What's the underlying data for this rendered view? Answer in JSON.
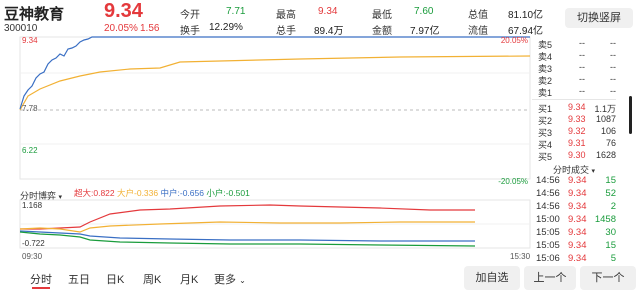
{
  "header": {
    "name": "豆神教育",
    "code": "300010",
    "price": "9.34",
    "change_pct": "20.05%",
    "change_abs": "1.56",
    "switch_button": "切换竖屏",
    "stats": [
      {
        "label": "今开",
        "value": "7.71",
        "color": "green"
      },
      {
        "label": "最高",
        "value": "9.34",
        "color": "red"
      },
      {
        "label": "最低",
        "value": "7.60",
        "color": "green"
      },
      {
        "label": "总值",
        "value": "81.10亿",
        "color": "black"
      },
      {
        "label": "换手",
        "value": "12.29%",
        "color": "black"
      },
      {
        "label": "总手",
        "value": "89.4万",
        "color": "black"
      },
      {
        "label": "金额",
        "value": "7.97亿",
        "color": "black"
      },
      {
        "label": "流值",
        "value": "67.94亿",
        "color": "black"
      }
    ]
  },
  "price_chart": {
    "y_top": "9.34",
    "y_ref": "7.78",
    "y_bottom": "6.22",
    "pct_top": "20.05%",
    "pct_bottom": "-20.05%"
  },
  "flow_chart": {
    "label": "分时博弈",
    "legend": [
      {
        "text": "超大:0.822",
        "color": "#e4393c"
      },
      {
        "text": "大户-0.336",
        "color": "#f2b134"
      },
      {
        "text": "中户:-0.656",
        "color": "#3a6fc4"
      },
      {
        "text": "小户:-0.501",
        "color": "#1a9c3c"
      }
    ],
    "y_top": "1.168",
    "y_bottom": "-0.722",
    "x_start": "09:30",
    "x_end": "15:30"
  },
  "order_book": {
    "asks": [
      {
        "label": "卖5",
        "price": "--",
        "vol": "--"
      },
      {
        "label": "卖4",
        "price": "--",
        "vol": "--"
      },
      {
        "label": "卖3",
        "price": "--",
        "vol": "--"
      },
      {
        "label": "卖2",
        "price": "--",
        "vol": "--"
      },
      {
        "label": "卖1",
        "price": "--",
        "vol": "--"
      }
    ],
    "bids": [
      {
        "label": "买1",
        "price": "9.34",
        "vol": "1.1万"
      },
      {
        "label": "买2",
        "price": "9.33",
        "vol": "1087"
      },
      {
        "label": "买3",
        "price": "9.32",
        "vol": "106"
      },
      {
        "label": "买4",
        "price": "9.31",
        "vol": "76"
      },
      {
        "label": "买5",
        "price": "9.30",
        "vol": "1628"
      }
    ]
  },
  "trades": {
    "title": "分时成交",
    "rows": [
      {
        "time": "14:56",
        "price": "9.34",
        "vol": "15",
        "color": "green"
      },
      {
        "time": "14:56",
        "price": "9.34",
        "vol": "52",
        "color": "green"
      },
      {
        "time": "14:56",
        "price": "9.34",
        "vol": "2",
        "color": "green"
      },
      {
        "time": "15:00",
        "price": "9.34",
        "vol": "1458",
        "color": "green"
      },
      {
        "time": "15:05",
        "price": "9.34",
        "vol": "30",
        "color": "green"
      },
      {
        "time": "15:05",
        "price": "9.34",
        "vol": "15",
        "color": "green"
      },
      {
        "time": "15:06",
        "price": "9.34",
        "vol": "5",
        "color": "green"
      }
    ]
  },
  "tabs": [
    "分时",
    "五日",
    "日K",
    "周K",
    "月K",
    "更多"
  ],
  "buttons": {
    "add_watch": "加自选",
    "prev": "上一个",
    "next": "下一个"
  }
}
